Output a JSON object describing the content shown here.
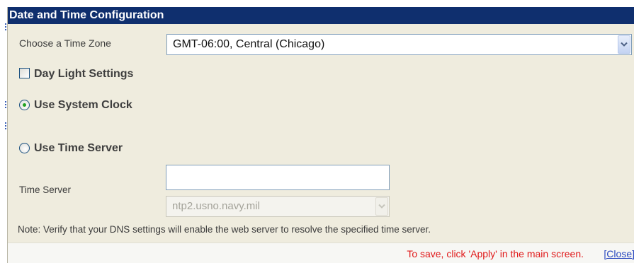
{
  "dialog": {
    "title": "Date and Time Configuration"
  },
  "timezone": {
    "label": "Choose a Time Zone",
    "selected": "GMT-06:00, Central (Chicago)"
  },
  "daylight": {
    "label": "Day Light Settings",
    "checked": false
  },
  "clock_mode": {
    "system_clock_label": "Use System Clock",
    "time_server_label": "Use Time Server",
    "selected": "system_clock"
  },
  "time_server": {
    "label": "Time Server",
    "input_value": "",
    "selected_server": "ntp2.usno.navy.mil"
  },
  "note": "Note: Verify that your DNS settings will enable the web server to resolve the specified time server.",
  "footer": {
    "save_message": "To save, click 'Apply' in the main screen.",
    "close_label": "[Close]"
  },
  "colors": {
    "titlebar": "#0f2f6e",
    "panel": "#efecde",
    "save_message": "#e0191a",
    "link": "#2a49c0",
    "radio_dot": "#21a121"
  },
  "icons": {
    "dropdown_arrow": "chevron-down-icon"
  }
}
